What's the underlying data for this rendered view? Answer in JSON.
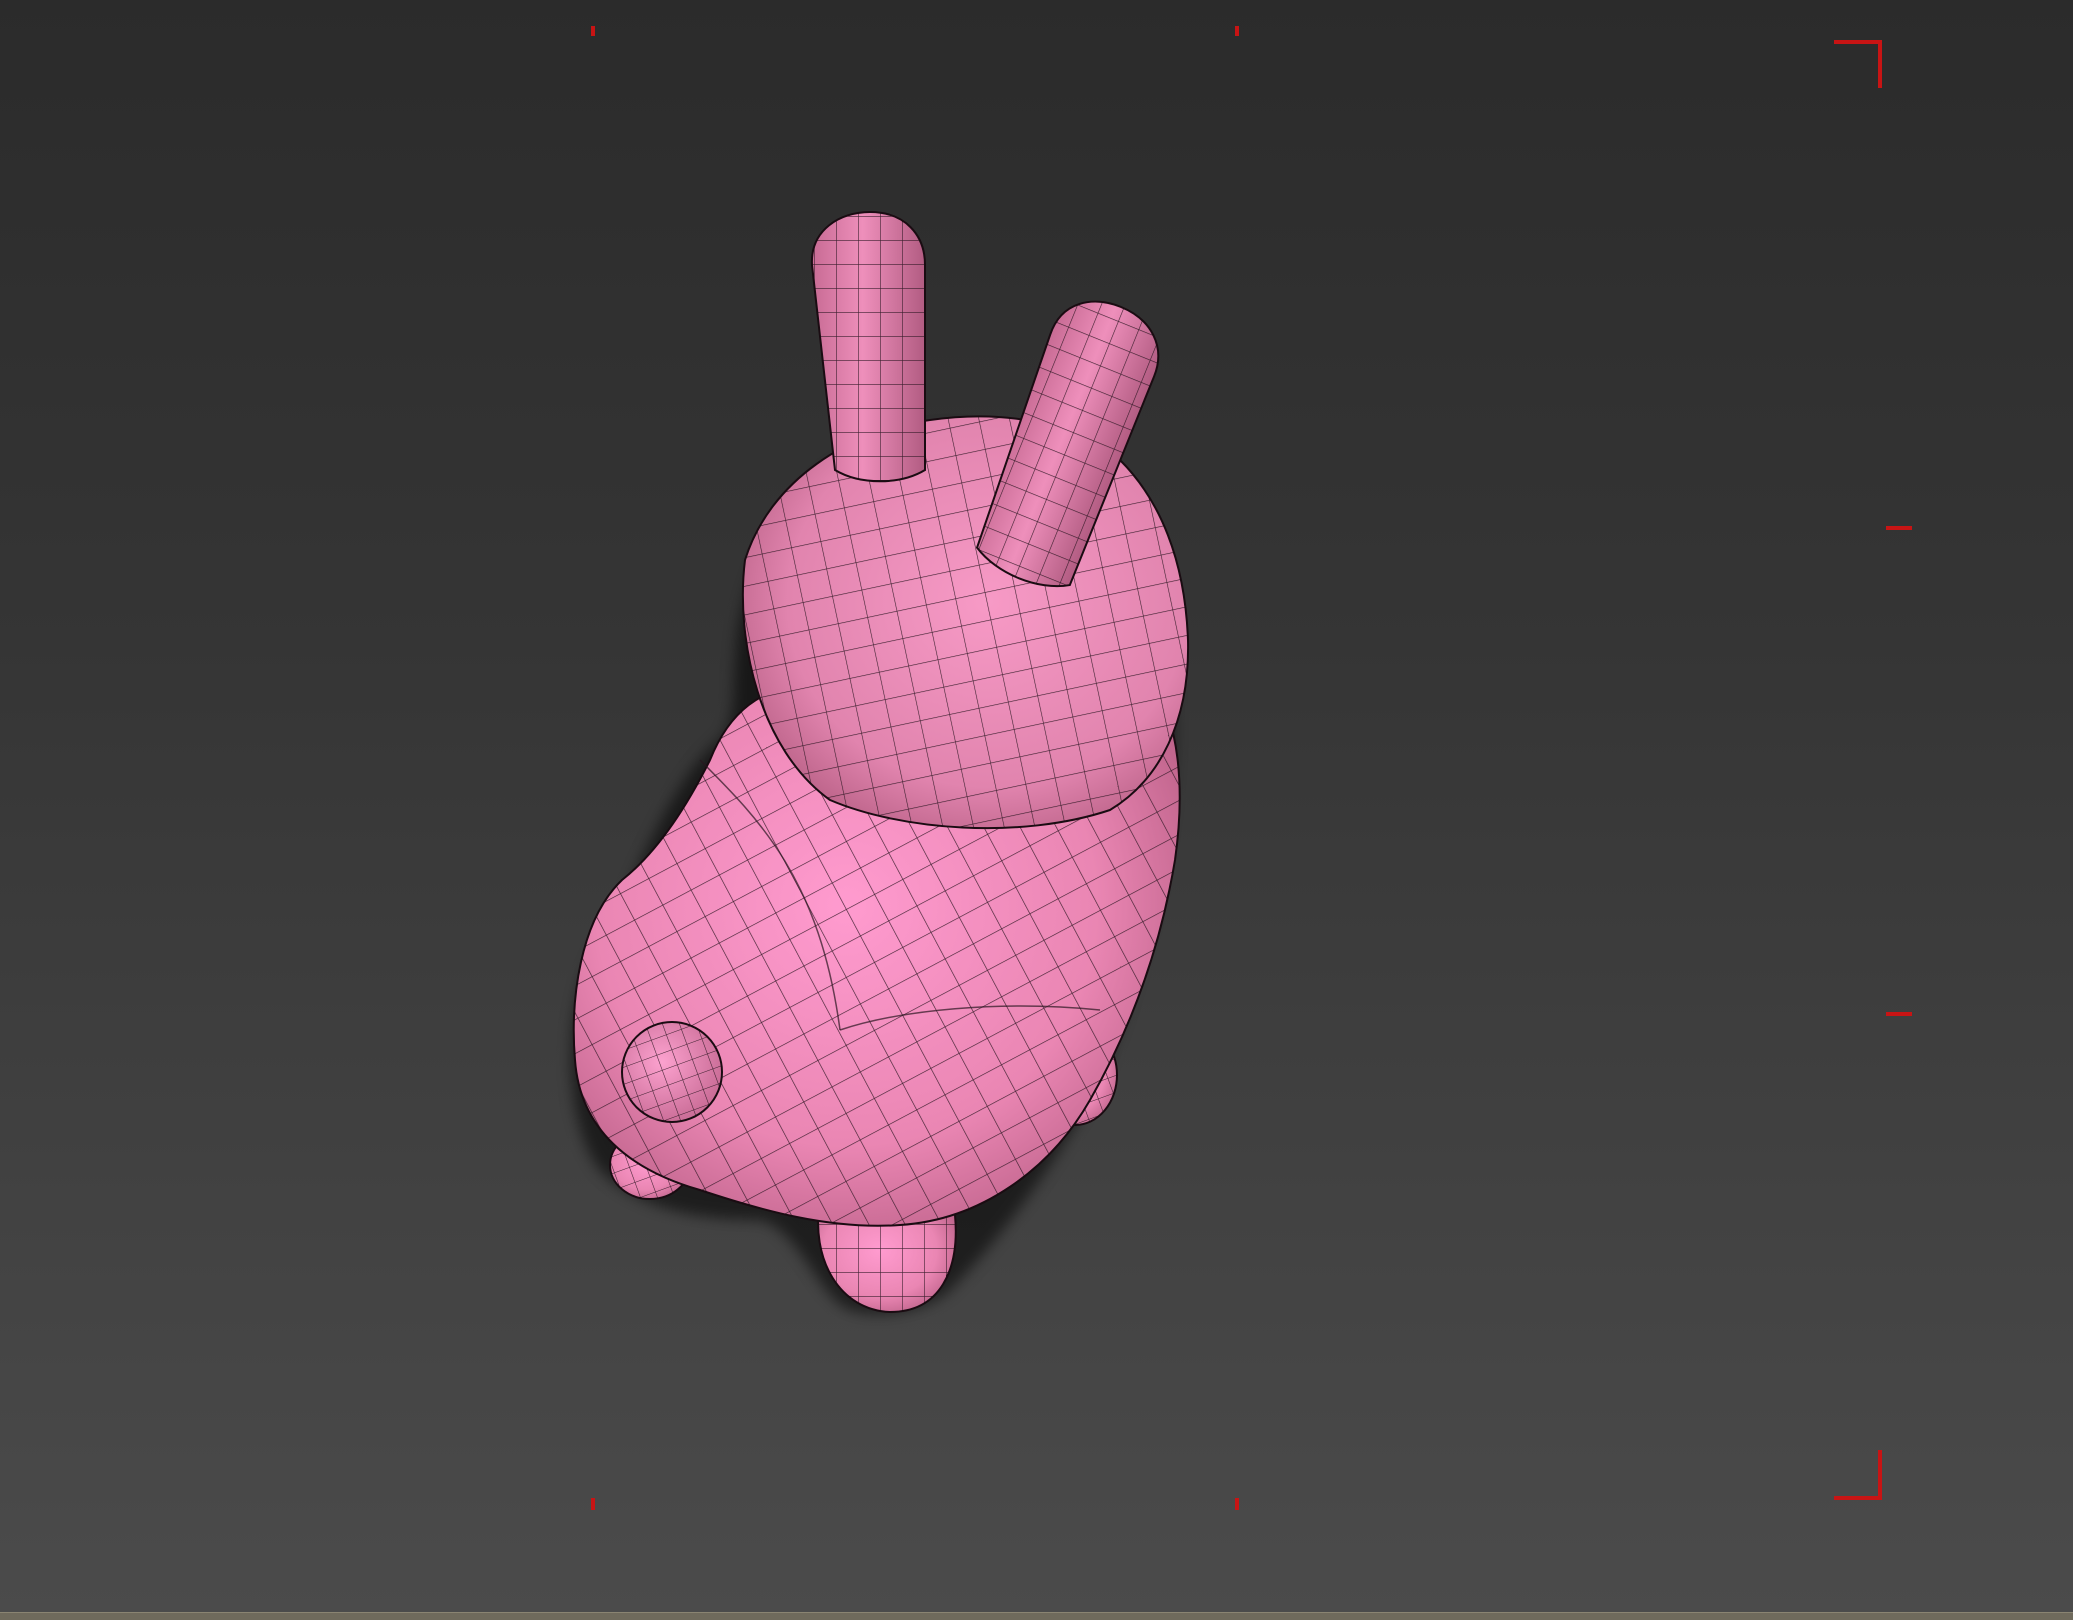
{
  "viewport": {
    "object_name": "bunny-mesh",
    "display_mode": "smooth-shaded-with-wireframe",
    "mesh_color": "#f08fbd",
    "mesh_shadow_color": "#b9577f",
    "wire_color": "#2a1520",
    "background_top": "#2b2b2b",
    "background_bottom": "#4b4b4b",
    "safe_frame_color": "#c81414"
  }
}
